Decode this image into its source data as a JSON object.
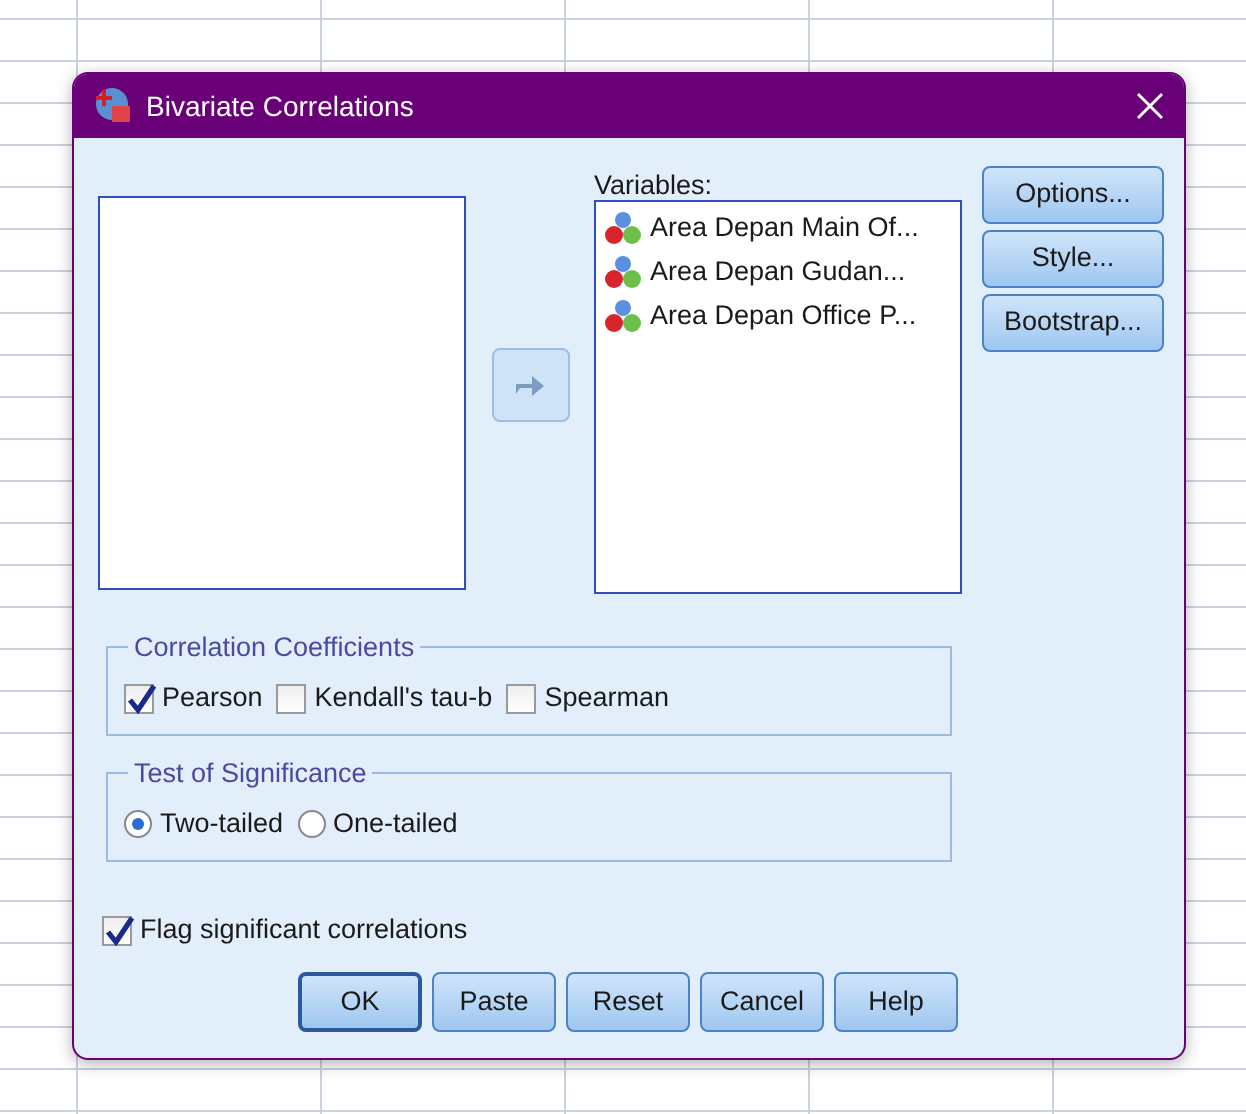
{
  "window": {
    "title": "Bivariate Correlations"
  },
  "variables": {
    "label": "Variables:",
    "items": [
      {
        "label": "Area Depan Main Of..."
      },
      {
        "label": "Area Depan Gudan..."
      },
      {
        "label": "Area Depan Office P..."
      }
    ]
  },
  "side_buttons": [
    {
      "label": "Options..."
    },
    {
      "label": "Style..."
    },
    {
      "label": "Bootstrap..."
    }
  ],
  "coefficients": {
    "title": "Correlation Coefficients",
    "options": [
      {
        "label": "Pearson",
        "checked": true
      },
      {
        "label": "Kendall's tau-b",
        "checked": false
      },
      {
        "label": "Spearman",
        "checked": false
      }
    ]
  },
  "significance": {
    "title": "Test of Significance",
    "options": [
      {
        "label": "Two-tailed",
        "selected": true
      },
      {
        "label": "One-tailed",
        "selected": false
      }
    ]
  },
  "flag": {
    "label": "Flag significant correlations",
    "checked": true
  },
  "buttons": [
    {
      "label": "OK",
      "default": true
    },
    {
      "label": "Paste",
      "default": false
    },
    {
      "label": "Reset",
      "default": false
    },
    {
      "label": "Cancel",
      "default": false
    },
    {
      "label": "Help",
      "default": false
    }
  ]
}
